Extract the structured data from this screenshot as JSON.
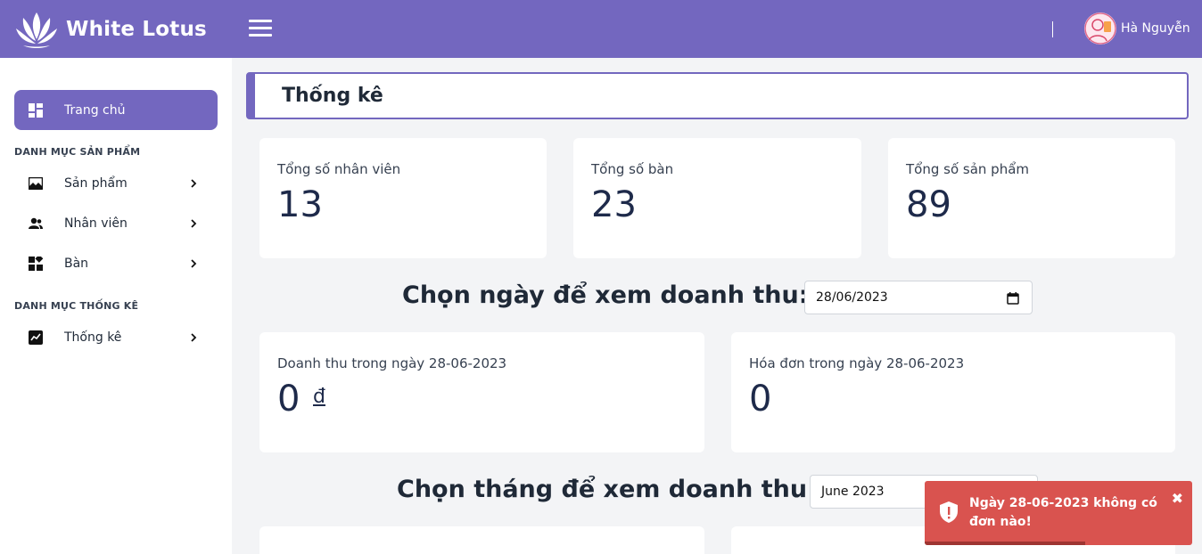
{
  "header": {
    "brand": "White Lotus",
    "user_name": "Hà Nguyễn",
    "icons": [
      "lotus-logo",
      "hamburger-menu-icon",
      "user-avatar"
    ]
  },
  "sidebar": {
    "home_label": "Trang chủ",
    "section_products": "DANH MỤC SẢN PHẨM",
    "items_products": [
      {
        "label": "Sản phẩm",
        "icon": "image-icon"
      },
      {
        "label": "Nhân viên",
        "icon": "users-icon"
      },
      {
        "label": "Bàn",
        "icon": "grid-icon"
      }
    ],
    "section_stats": "DANH MỤC THỐNG KÊ",
    "items_stats": [
      {
        "label": "Thống kê",
        "icon": "chart-icon"
      }
    ]
  },
  "main": {
    "title": "Thống kê",
    "cards": [
      {
        "label": "Tổng số nhân viên",
        "value": "13"
      },
      {
        "label": "Tổng số bàn",
        "value": "23"
      },
      {
        "label": "Tổng số sản phẩm",
        "value": "89"
      }
    ],
    "day_section": {
      "heading": "Chọn ngày để xem doanh thu:",
      "date_value": "28/06/2023",
      "revenue_label": "Doanh thu trong ngày 28-06-2023",
      "revenue_value": "0",
      "currency": "đ",
      "orders_label": "Hóa đơn trong ngày 28-06-2023",
      "orders_value": "0"
    },
    "month_section": {
      "heading": "Chọn tháng để xem doanh thu:",
      "month_value": "June 2023"
    }
  },
  "toast": {
    "message": "Ngày 28-06-2023 không có đơn nào!",
    "close": "✖",
    "progress": 0.6,
    "color": "#d9534f"
  },
  "colors": {
    "accent": "#7367bf",
    "background": "#f3f4f6"
  }
}
